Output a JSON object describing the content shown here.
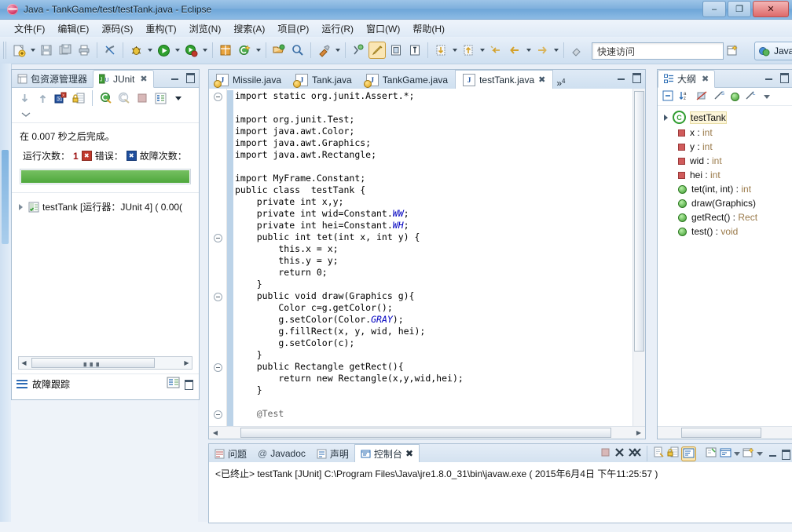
{
  "window": {
    "title": "Java - TankGame/test/testTank.java - Eclipse",
    "app_icon": "eclipse-icon",
    "minimize_label": "–",
    "maximize_label": "❐",
    "close_label": "✕"
  },
  "menu": {
    "items": [
      {
        "label": "文件(F)",
        "name": "menu-file"
      },
      {
        "label": "编辑(E)",
        "name": "menu-edit"
      },
      {
        "label": "源码(S)",
        "name": "menu-source"
      },
      {
        "label": "重构(T)",
        "name": "menu-refactor"
      },
      {
        "label": "浏览(N)",
        "name": "menu-navigate"
      },
      {
        "label": "搜索(A)",
        "name": "menu-search"
      },
      {
        "label": "项目(P)",
        "name": "menu-project"
      },
      {
        "label": "运行(R)",
        "name": "menu-run"
      },
      {
        "label": "窗口(W)",
        "name": "menu-window"
      },
      {
        "label": "帮助(H)",
        "name": "menu-help"
      }
    ]
  },
  "toolbar": {
    "quick_access_placeholder": "快速访问",
    "perspective_label": "Java",
    "perspective_icon": "java-perspective-icon",
    "open_perspective_icon": "open-perspective-icon",
    "buttons": [
      {
        "name": "new-wizard-button",
        "icon": "new-file-icon"
      },
      {
        "name": "save-button",
        "icon": "save-icon"
      },
      {
        "name": "save-all-button",
        "icon": "save-all-icon"
      },
      {
        "name": "print-button",
        "icon": "print-icon"
      },
      {
        "name": "toggle-mark-occurrences-button",
        "icon": "mark-occurrences-icon"
      },
      {
        "name": "debug-button",
        "icon": "debug-bug-icon"
      },
      {
        "name": "run-button",
        "icon": "run-play-icon"
      },
      {
        "name": "run-coverage-button",
        "icon": "coverage-icon"
      },
      {
        "name": "new-java-package-button",
        "icon": "package-icon"
      },
      {
        "name": "new-java-class-button",
        "icon": "class-icon"
      },
      {
        "name": "open-type-button",
        "icon": "open-type-icon"
      },
      {
        "name": "search-button",
        "icon": "search-icon"
      },
      {
        "name": "external-tools-button",
        "icon": "external-tools-icon"
      },
      {
        "name": "skip-breakpoints-button",
        "icon": "skip-breakpoints-icon"
      },
      {
        "name": "toggle-java-editor-button",
        "icon": "pencil-icon"
      },
      {
        "name": "toggle-block-selection-button",
        "icon": "block-selection-icon"
      },
      {
        "name": "show-whitespace-button",
        "icon": "whitespace-icon"
      },
      {
        "name": "next-annotation-button",
        "icon": "next-annotation-icon"
      },
      {
        "name": "previous-annotation-button",
        "icon": "previous-annotation-icon"
      },
      {
        "name": "last-edit-location-button",
        "icon": "last-edit-icon"
      },
      {
        "name": "back-button",
        "icon": "back-arrow-icon"
      },
      {
        "name": "forward-button",
        "icon": "forward-arrow-icon"
      },
      {
        "name": "pin-editor-button",
        "icon": "pin-icon"
      }
    ]
  },
  "junit": {
    "tabs": [
      {
        "label": "包资源管理器",
        "name": "tab-package-explorer",
        "active": false,
        "icon": "package-explorer-icon"
      },
      {
        "label": "JUnit",
        "name": "tab-junit",
        "active": true,
        "icon": "junit-icon"
      }
    ],
    "toolbar": [
      {
        "name": "next-failure-button",
        "icon": "next-failure-arrow-icon"
      },
      {
        "name": "previous-failure-button",
        "icon": "previous-failure-arrow-icon"
      },
      {
        "name": "show-failures-only-button",
        "icon": "show-failures-icon"
      },
      {
        "name": "scroll-lock-button",
        "icon": "scroll-lock-icon"
      },
      {
        "name": "rerun-test-button",
        "icon": "rerun-test-icon"
      },
      {
        "name": "rerun-failed-tests-button",
        "icon": "rerun-failed-icon"
      },
      {
        "name": "stop-button",
        "icon": "stop-icon"
      },
      {
        "name": "test-run-history-button",
        "icon": "history-icon"
      },
      {
        "name": "view-menu-button",
        "icon": "chevron-down-icon"
      },
      {
        "name": "minimize-more-button",
        "icon": "chevron-down-icon"
      }
    ],
    "status_text": "在 0.007 秒之后完成。",
    "counts": {
      "runs_label": "运行次数：",
      "runs_value": "1",
      "errors_label": "错误：",
      "errors_value": "",
      "failures_label": "故障次数：",
      "failures_value": "",
      "error_badge": "☒",
      "failure_badge": "☒"
    },
    "progress": {
      "percent": 100,
      "color": "#4fa83c"
    },
    "tree": [
      {
        "label": "testTank [运行器：JUnit 4] ( 0.00(",
        "name": "junit-tree-item-testtank",
        "icon": "test-suite-icon"
      }
    ],
    "failure_trace": {
      "label": "故障跟踪",
      "icon": "failure-trace-icon",
      "buttons": [
        {
          "name": "compare-result-button",
          "icon": "compare-icon"
        },
        {
          "name": "maximize-trace-button",
          "icon": "maximize-icon"
        }
      ]
    }
  },
  "editor": {
    "tabs": [
      {
        "label": "Missile.java",
        "name": "editor-tab-missile",
        "active": false,
        "dirty": false
      },
      {
        "label": "Tank.java",
        "name": "editor-tab-tank",
        "active": false,
        "dirty": false
      },
      {
        "label": "TankGame.java",
        "name": "editor-tab-tankgame",
        "active": false,
        "dirty": false
      },
      {
        "label": "testTank.java",
        "name": "editor-tab-testtank",
        "active": true,
        "dirty": false
      }
    ],
    "more_tabs_indicator": "»",
    "more_tabs_count": "4",
    "close_glyph": "✖",
    "code_lines": [
      {
        "text": "import static org.junit.Assert.*;",
        "indent": 0,
        "fold": true
      },
      {
        "text": "",
        "indent": 0
      },
      {
        "text": "import org.junit.Test;",
        "indent": 0
      },
      {
        "text": "import java.awt.Color;",
        "indent": 0
      },
      {
        "text": "import java.awt.Graphics;",
        "indent": 0
      },
      {
        "text": "import java.awt.Rectangle;",
        "indent": 0
      },
      {
        "text": "",
        "indent": 0
      },
      {
        "text": "import MyFrame.Constant;",
        "indent": 0
      },
      {
        "text": "public class  testTank {",
        "indent": 0
      },
      {
        "text": "private int x,y;",
        "indent": 1
      },
      {
        "text": "private int wid=Constant.WW;",
        "indent": 1
      },
      {
        "text": "private int hei=Constant.WH;",
        "indent": 1
      },
      {
        "text": "public int tet(int x, int y) {",
        "indent": 1,
        "fold": true
      },
      {
        "text": "this.x = x;",
        "indent": 2
      },
      {
        "text": "this.y = y;",
        "indent": 2
      },
      {
        "text": "return 0;",
        "indent": 2
      },
      {
        "text": "}",
        "indent": 1
      },
      {
        "text": "public void draw(Graphics g){",
        "indent": 1,
        "fold": true
      },
      {
        "text": "Color c=g.getColor();",
        "indent": 2
      },
      {
        "text": "g.setColor(Color.GRAY);",
        "indent": 2
      },
      {
        "text": "g.fillRect(x, y, wid, hei);",
        "indent": 2
      },
      {
        "text": "g.setColor(c);",
        "indent": 2
      },
      {
        "text": "}",
        "indent": 1
      },
      {
        "text": "public Rectangle getRect(){",
        "indent": 1,
        "fold": true
      },
      {
        "text": "return new Rectangle(x,y,wid,hei);",
        "indent": 2
      },
      {
        "text": "}",
        "indent": 1
      },
      {
        "text": "",
        "indent": 0
      },
      {
        "text": "@Test",
        "indent": 1,
        "fold": true
      }
    ]
  },
  "outline": {
    "tab_label": "大纲",
    "tab_icon": "outline-icon",
    "toolbar": [
      {
        "name": "collapse-all-button",
        "icon": "collapse-all-icon"
      },
      {
        "name": "sort-button",
        "icon": "sort-az-icon"
      },
      {
        "name": "hide-fields-button",
        "icon": "hide-fields-icon"
      },
      {
        "name": "hide-static-button",
        "icon": "hide-static-icon"
      },
      {
        "name": "hide-non-public-button",
        "icon": "hide-nonpublic-icon"
      },
      {
        "name": "hide-local-types-button",
        "icon": "hide-local-icon"
      },
      {
        "name": "view-menu-button",
        "icon": "chevron-down-icon"
      }
    ],
    "root": {
      "label": "testTank",
      "icon": "class-icon",
      "name": "outline-root-testtank"
    },
    "members": [
      {
        "label": "x : int",
        "icon": "field-private-icon",
        "name": "outline-field-x"
      },
      {
        "label": "y : int",
        "icon": "field-private-icon",
        "name": "outline-field-y"
      },
      {
        "label": "wid : int",
        "icon": "field-private-icon",
        "name": "outline-field-wid"
      },
      {
        "label": "hei : int",
        "icon": "field-private-icon",
        "name": "outline-field-hei"
      },
      {
        "label": "tet(int, int) : int",
        "icon": "method-public-icon",
        "name": "outline-method-tet"
      },
      {
        "label": "draw(Graphics)",
        "icon": "method-public-icon",
        "name": "outline-method-draw"
      },
      {
        "label": "getRect() : Rect",
        "icon": "method-public-icon",
        "name": "outline-method-getrect"
      },
      {
        "label": "test() : void",
        "icon": "method-public-icon",
        "name": "outline-method-test"
      }
    ]
  },
  "console": {
    "tabs": [
      {
        "label": "问题",
        "name": "console-tab-problems",
        "active": false,
        "icon": "problems-icon"
      },
      {
        "label": "Javadoc",
        "name": "console-tab-javadoc",
        "active": false,
        "icon": "javadoc-icon"
      },
      {
        "label": "声明",
        "name": "console-tab-declaration",
        "active": false,
        "icon": "declaration-icon"
      },
      {
        "label": "控制台",
        "name": "console-tab-console",
        "active": true,
        "icon": "console-icon"
      }
    ],
    "tools": [
      {
        "name": "terminate-button",
        "icon": "terminate-icon"
      },
      {
        "name": "remove-launch-button",
        "icon": "remove-launch-icon"
      },
      {
        "name": "remove-all-terminated-button",
        "icon": "remove-all-icon"
      },
      {
        "name": "clear-console-button",
        "icon": "clear-console-icon"
      },
      {
        "name": "scroll-lock-button",
        "icon": "scroll-lock-icon"
      },
      {
        "name": "pin-console-button",
        "icon": "pin-console-icon"
      },
      {
        "name": "display-selected-console-button",
        "icon": "display-console-icon"
      },
      {
        "name": "open-console-button",
        "icon": "open-console-icon"
      },
      {
        "name": "new-console-view-button",
        "icon": "new-console-icon"
      }
    ],
    "output_line": "<已终止> testTank [JUnit] C:\\Program Files\\Java\\jre1.8.0_31\\bin\\javaw.exe ( 2015年6月4日 下午11:25:57 )"
  }
}
